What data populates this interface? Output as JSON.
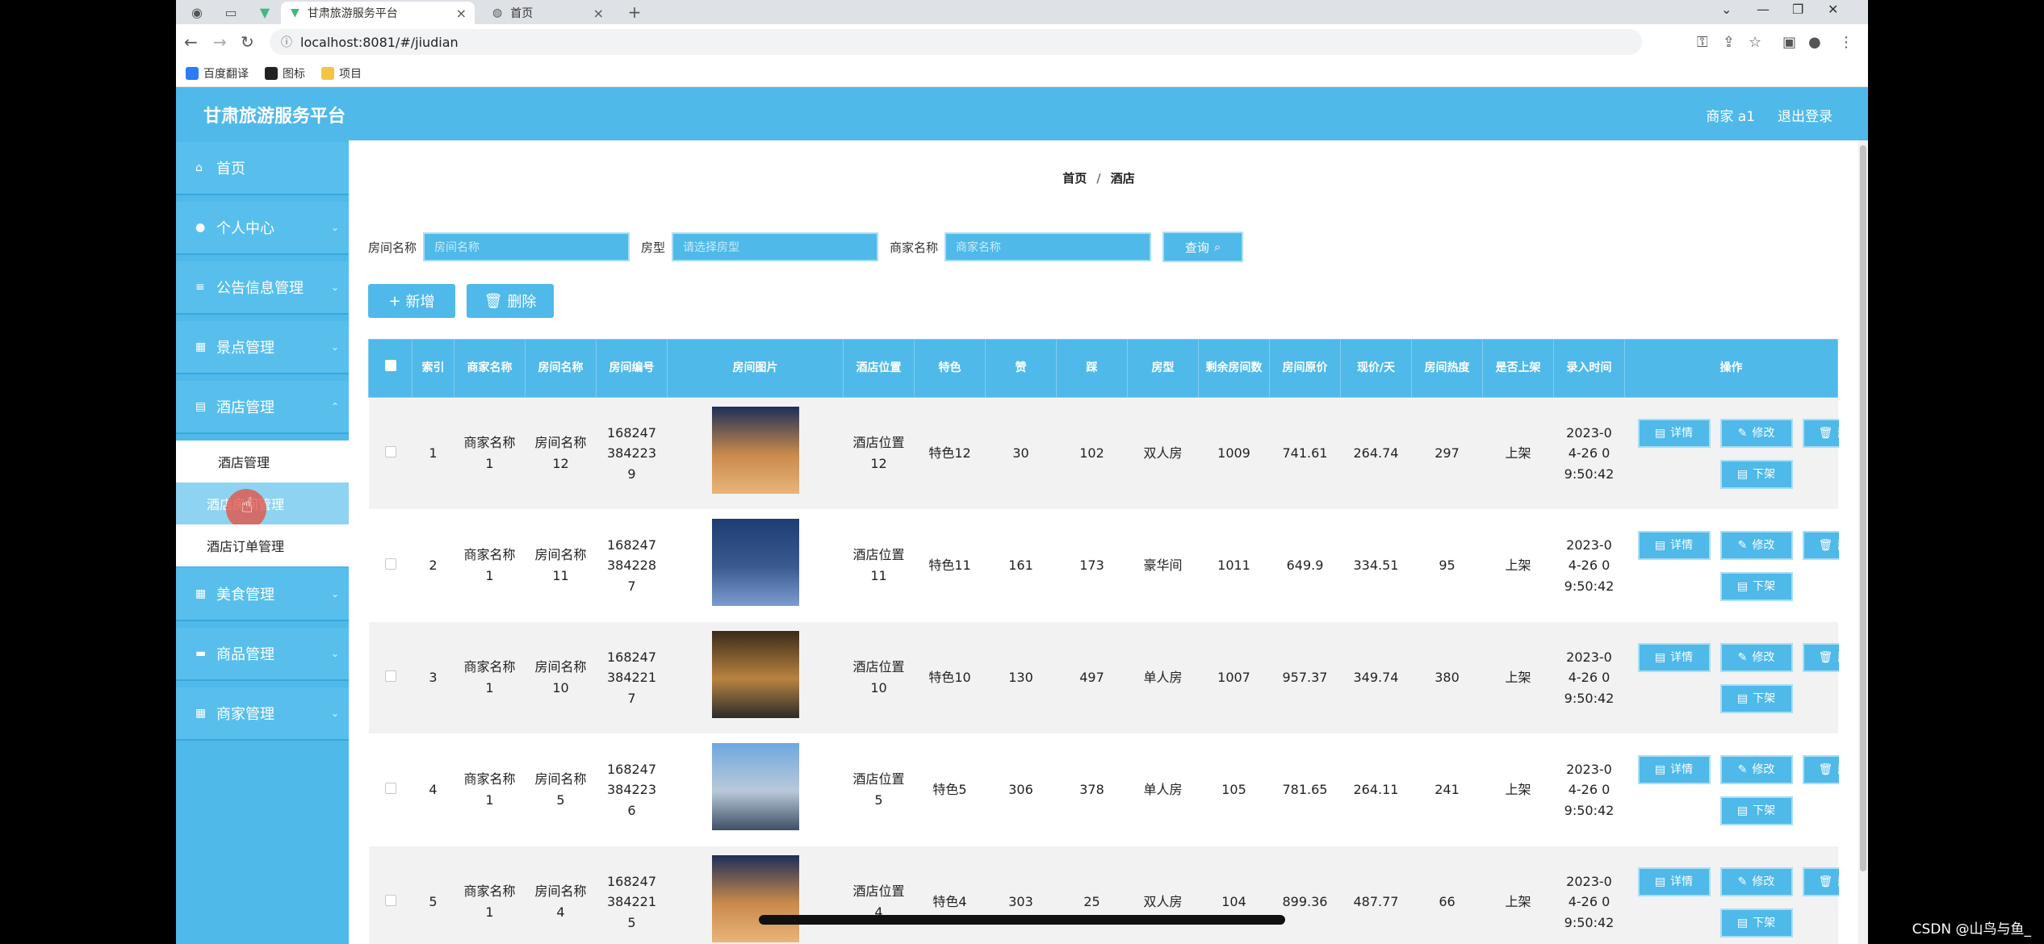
{
  "browser": {
    "tabs": [
      {
        "title": "甘肃旅游服务平台",
        "active": true
      },
      {
        "title": "首页",
        "active": false
      }
    ],
    "url": "localhost:8081/#/jiudian",
    "bookmarks": [
      "百度翻译",
      "图标",
      "项目"
    ]
  },
  "app": {
    "brand": "甘肃旅游服务平台",
    "user": "商家 a1",
    "logout": "退出登录"
  },
  "sidebar": {
    "menus": [
      {
        "label": "首页",
        "icon": "home-icon"
      },
      {
        "label": "个人中心",
        "icon": "user-icon"
      },
      {
        "label": "公告信息管理",
        "icon": "list-icon"
      },
      {
        "label": "景点管理",
        "icon": "grid-icon"
      },
      {
        "label": "酒店管理",
        "icon": "list-icon"
      }
    ],
    "submenus": [
      "酒店管理",
      "酒店房间管理",
      "酒店订单管理"
    ],
    "menus_after": [
      {
        "label": "美食管理",
        "icon": "grid-icon"
      },
      {
        "label": "商品管理",
        "icon": "card-icon"
      },
      {
        "label": "商家管理",
        "icon": "grid-icon"
      }
    ]
  },
  "breadcrumb": {
    "home": "首页",
    "sep": "/",
    "current": "酒店"
  },
  "search": {
    "room_name_label": "房间名称",
    "room_name_placeholder": "房间名称",
    "room_type_label": "房型",
    "room_type_placeholder": "请选择房型",
    "merchant_label": "商家名称",
    "merchant_placeholder": "商家名称",
    "query_label": "查询"
  },
  "toolbar": {
    "add_label": "新增",
    "delete_label": "删除"
  },
  "table": {
    "headers": [
      "",
      "索引",
      "商家名称",
      "房间名称",
      "房间编号",
      "房间图片",
      "酒店位置",
      "特色",
      "赞",
      "踩",
      "房型",
      "剩余房间数",
      "房间原价",
      "现价/天",
      "房间热度",
      "是否上架",
      "录入时间",
      "操作"
    ],
    "rows": [
      {
        "index": "1",
        "merchant": "商家名称1",
        "room": "房间名称12",
        "code": "1682473842239",
        "location": "酒店位置12",
        "feature": "特色12",
        "likes": "30",
        "dislikes": "102",
        "type": "双人房",
        "remaining": "1009",
        "orig": "741.61",
        "price": "264.74",
        "heat": "297",
        "listed": "上架",
        "time": "2023-04-26 09:50:42"
      },
      {
        "index": "2",
        "merchant": "商家名称1",
        "room": "房间名称11",
        "code": "1682473842287",
        "location": "酒店位置11",
        "feature": "特色11",
        "likes": "161",
        "dislikes": "173",
        "type": "豪华间",
        "remaining": "1011",
        "orig": "649.9",
        "price": "334.51",
        "heat": "95",
        "listed": "上架",
        "time": "2023-04-26 09:50:42"
      },
      {
        "index": "3",
        "merchant": "商家名称1",
        "room": "房间名称10",
        "code": "1682473842217",
        "location": "酒店位置10",
        "feature": "特色10",
        "likes": "130",
        "dislikes": "497",
        "type": "单人房",
        "remaining": "1007",
        "orig": "957.37",
        "price": "349.74",
        "heat": "380",
        "listed": "上架",
        "time": "2023-04-26 09:50:42"
      },
      {
        "index": "4",
        "merchant": "商家名称1",
        "room": "房间名称5",
        "code": "1682473842236",
        "location": "酒店位置5",
        "feature": "特色5",
        "likes": "306",
        "dislikes": "378",
        "type": "单人房",
        "remaining": "105",
        "orig": "781.65",
        "price": "264.11",
        "heat": "241",
        "listed": "上架",
        "time": "2023-04-26 09:50:42"
      },
      {
        "index": "5",
        "merchant": "商家名称1",
        "room": "房间名称4",
        "code": "1682473842215",
        "location": "酒店位置4",
        "feature": "特色4",
        "likes": "303",
        "dislikes": "25",
        "type": "双人房",
        "remaining": "104",
        "orig": "899.36",
        "price": "487.77",
        "heat": "66",
        "listed": "上架",
        "time": "2023-04-26 09:50:42"
      }
    ],
    "op_detail": "详情",
    "op_edit": "修改",
    "op_delete": "删除",
    "op_unlist": "下架"
  },
  "watermark": "CSDN @山鸟与鱼_",
  "colors": {
    "primary": "#4fb9e9",
    "primary_border": "#a9def5"
  }
}
